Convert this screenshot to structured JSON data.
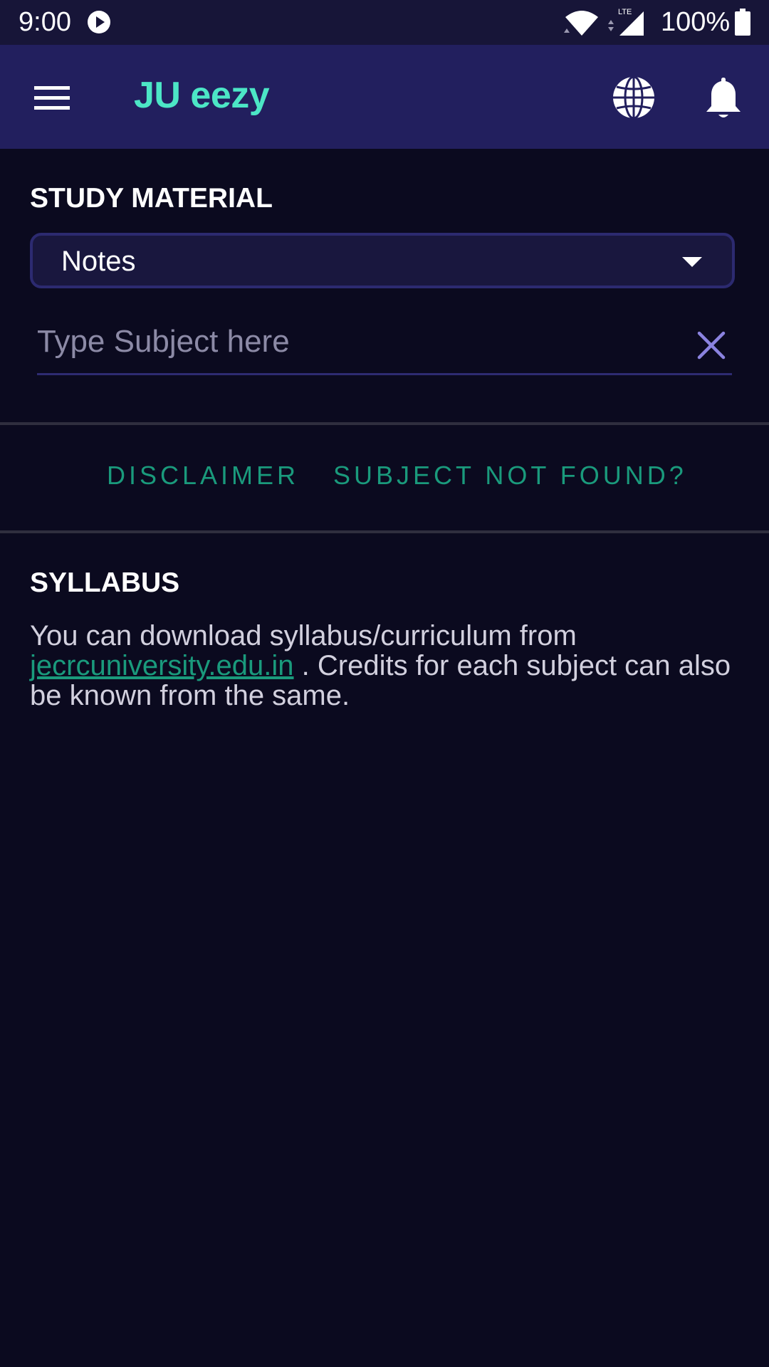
{
  "status_bar": {
    "time": "9:00",
    "battery": "100%",
    "icons": [
      "play-icon",
      "wifi-icon",
      "lte-signal-icon",
      "battery-icon"
    ]
  },
  "app_bar": {
    "title": "JU eezy",
    "icons": [
      "hamburger-menu-icon",
      "globe-icon",
      "bell-icon"
    ],
    "accent_color": "#4ce6c6",
    "background": "#221f5e"
  },
  "study_material": {
    "heading": "STUDY MATERIAL",
    "dropdown_selected": "Notes",
    "subject_input": {
      "value": "",
      "placeholder": "Type Subject here"
    }
  },
  "actions": {
    "disclaimer_label": "DISCLAIMER",
    "subject_not_found_label": "SUBJECT NOT FOUND?"
  },
  "syllabus": {
    "heading": "SYLLABUS",
    "text_before_link": "You can download syllabus/curriculum from ",
    "link_text": "jecrcuniversity.edu.in",
    "text_after_link": " . Credits for each subject can also be known from the same."
  },
  "colors": {
    "background": "#0b0a1f",
    "link_green": "#1a9a7c"
  }
}
